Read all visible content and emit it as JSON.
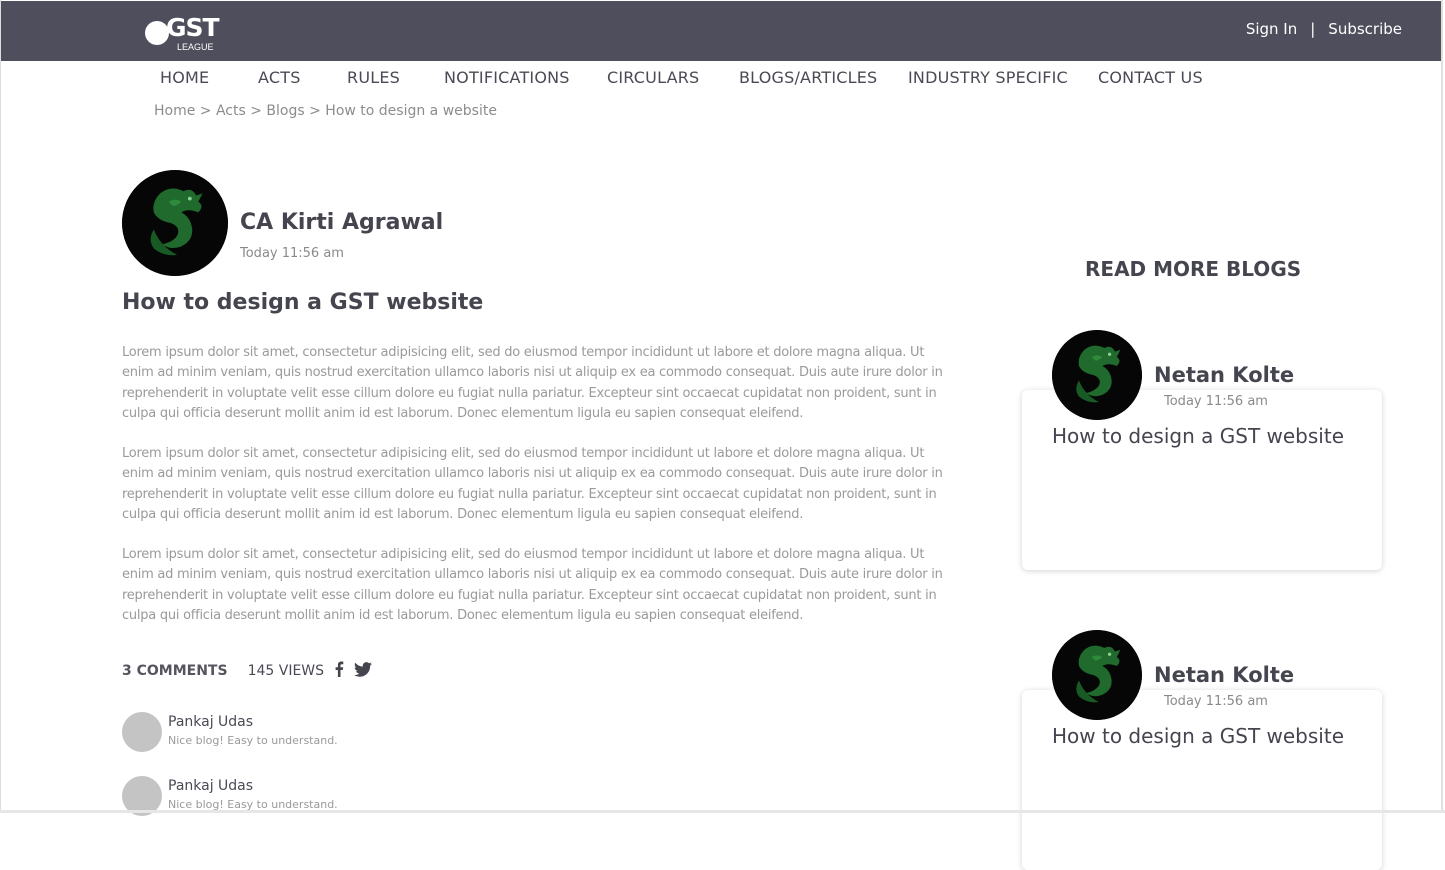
{
  "brand": {
    "logo_text": "GST",
    "logo_subtext": "LEAGUE",
    "bar_color": "#4e4e5c"
  },
  "top_links": {
    "sign_in": "Sign In",
    "separator": "|",
    "subscribe": "Subscribe"
  },
  "nav": {
    "items": [
      "HOME",
      "ACTS",
      "RULES",
      "NOTIFICATIONS",
      "CIRCULARS",
      "BLOGS/ARTICLES",
      "INDUSTRY SPECIFIC",
      "CONTACT US"
    ]
  },
  "breadcrumb": "Home > Acts > Blogs > How to design a website",
  "article": {
    "author": "CA Kirti Agrawal",
    "date": "Today 11:56 am",
    "title": "How to design a GST website",
    "paragraphs": [
      "Lorem ipsum dolor sit amet, consectetur adipisicing elit, sed do eiusmod tempor incididunt ut labore et dolore magna aliqua. Ut enim ad minim veniam, quis nostrud exercitation ullamco laboris nisi ut aliquip ex ea commodo consequat. Duis aute irure dolor in reprehenderit in voluptate velit esse cillum dolore eu fugiat nulla pariatur. Excepteur sint occaecat cupidatat non proident, sunt in culpa qui officia deserunt mollit anim id est laborum. Donec elementum ligula eu sapien consequat eleifend.",
      "Lorem ipsum dolor sit amet, consectetur adipisicing elit, sed do eiusmod tempor incididunt ut labore et dolore magna aliqua. Ut enim ad minim veniam, quis nostrud exercitation ullamco laboris nisi ut aliquip ex ea commodo consequat. Duis aute irure dolor in reprehenderit in voluptate velit esse cillum dolore eu fugiat nulla pariatur. Excepteur sint occaecat cupidatat non proident, sunt in culpa qui officia deserunt mollit anim id est laborum. Donec elementum ligula eu sapien consequat eleifend.",
      "Lorem ipsum dolor sit amet, consectetur adipisicing elit, sed do eiusmod tempor incididunt ut labore et dolore magna aliqua. Ut enim ad minim veniam, quis nostrud exercitation ullamco laboris nisi ut aliquip ex ea commodo consequat. Duis aute irure dolor in reprehenderit in voluptate velit esse cillum dolore eu fugiat nulla pariatur. Excepteur sint occaecat cupidatat non proident, sunt in culpa qui officia deserunt mollit anim id est laborum. Donec elementum ligula eu sapien consequat eleifend."
    ],
    "comments_count": "3 COMMENTS",
    "views": "145 VIEWS",
    "social_icons": [
      "facebook-icon",
      "twitter-icon"
    ]
  },
  "comments": [
    {
      "author": "Pankaj Udas",
      "text": "Nice blog! Easy to understand."
    },
    {
      "author": "Pankaj Udas",
      "text": "Nice blog! Easy to understand."
    }
  ],
  "sidebar": {
    "title": "READ MORE BLOGS",
    "cards": [
      {
        "author": "Netan Kolte",
        "date": "Today 11:56 am",
        "title": "How to design a GST website"
      },
      {
        "author": "Netan Kolte",
        "date": "Today 11:56 am",
        "title": "How to design a GST website"
      }
    ]
  }
}
